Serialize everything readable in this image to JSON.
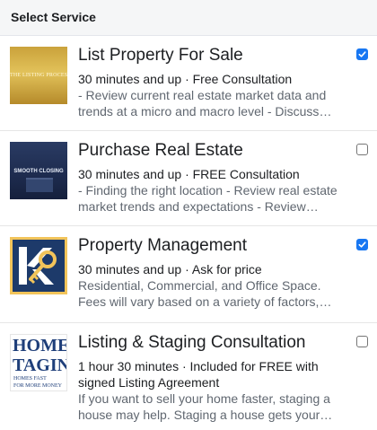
{
  "header": {
    "title": "Select Service"
  },
  "services": [
    {
      "title": "List Property For Sale",
      "meta": "30 minutes and up · Free Consultation",
      "description": "- Review current real estate market data and trends at a micro and macro level - Discuss the…",
      "thumb_caption": "THE LISTING PROCESS",
      "checked": true
    },
    {
      "title": "Purchase Real Estate",
      "meta": "30 minutes and up · FREE Consultation",
      "description": "- Finding the right location - Review real estate market trends and expectations - Review goal…",
      "thumb_caption": "SMOOTH CLOSING",
      "checked": false
    },
    {
      "title": "Property Management",
      "meta": "30 minutes and up · Ask for price",
      "description": "Residential, Commercial, and Office Space. Fees will vary based on a variety of factors,…",
      "thumb_caption": "",
      "checked": true
    },
    {
      "title": "Listing & Staging Consultation",
      "meta": "1 hour 30 minutes · Included for FREE with signed Listing Agreement",
      "description": "If you want to sell your home faster, staging a house may help. Staging a house gets your…",
      "thumb_caption": "HOME TAGIN",
      "thumb_caption_line1": "HOME",
      "thumb_caption_line2": "TAGIN",
      "thumb_caption_small1": "HOMES FAST",
      "thumb_caption_small2": "FOR MORE MONEY",
      "checked": false
    }
  ],
  "colors": {
    "accent": "#1877f2",
    "secondary_text": "#606770",
    "header_bg": "#f5f6f7"
  }
}
